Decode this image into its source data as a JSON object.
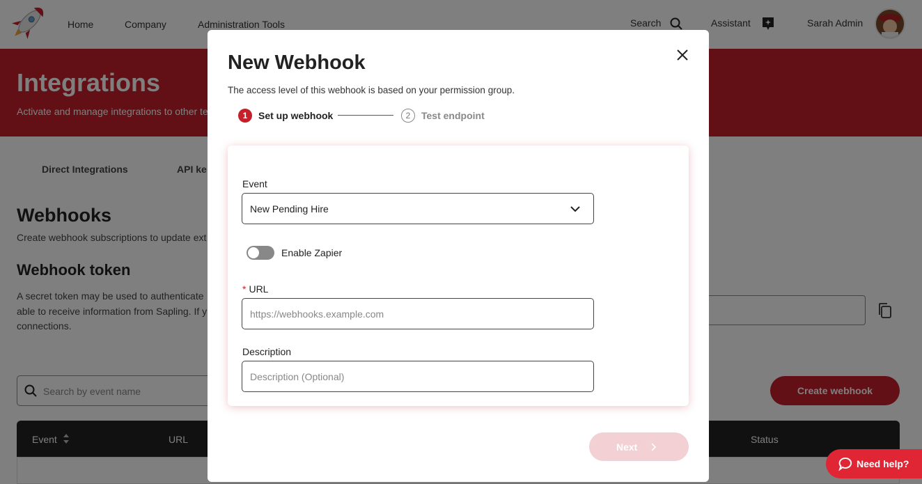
{
  "nav": {
    "links": [
      "Home",
      "Company",
      "Administration Tools"
    ],
    "search_label": "Search",
    "assistant_label": "Assistant",
    "user_name": "Sarah Admin"
  },
  "banner": {
    "title": "Integrations",
    "subtitle": "Activate and manage integrations to other te"
  },
  "tabs": [
    "Direct Integrations",
    "API ke"
  ],
  "webhooks": {
    "title": "Webhooks",
    "description": "Create webhook subscriptions to update ext",
    "token_title": "Webhook token",
    "token_text_lines": [
      "A secret token may be used to authenticate",
      "able to receive information from Sapling. If y",
      "connections."
    ],
    "search_placeholder": "Search by event name",
    "create_button": "Create webhook",
    "columns": [
      "Event",
      "URL",
      "Status"
    ]
  },
  "help_button": "Need help?",
  "modal": {
    "title": "New Webhook",
    "subtitle": "The access level of this webhook is based on your permission group.",
    "steps": [
      {
        "number": "1",
        "label": "Set up webhook",
        "active": true
      },
      {
        "number": "2",
        "label": "Test endpoint",
        "active": false
      }
    ],
    "event_label": "Event",
    "event_value": "New Pending Hire",
    "zapier_label": "Enable Zapier",
    "zapier_enabled": false,
    "url_required_mark": "*",
    "url_label": "URL",
    "url_placeholder": "https://webhooks.example.com",
    "description_label": "Description",
    "description_placeholder": "Description (Optional)",
    "next_button": "Next"
  },
  "colors": {
    "brand_red": "#c41f2a",
    "help_red": "#e02634",
    "next_disabled": "#f2d0d3",
    "table_header": "#222222"
  }
}
